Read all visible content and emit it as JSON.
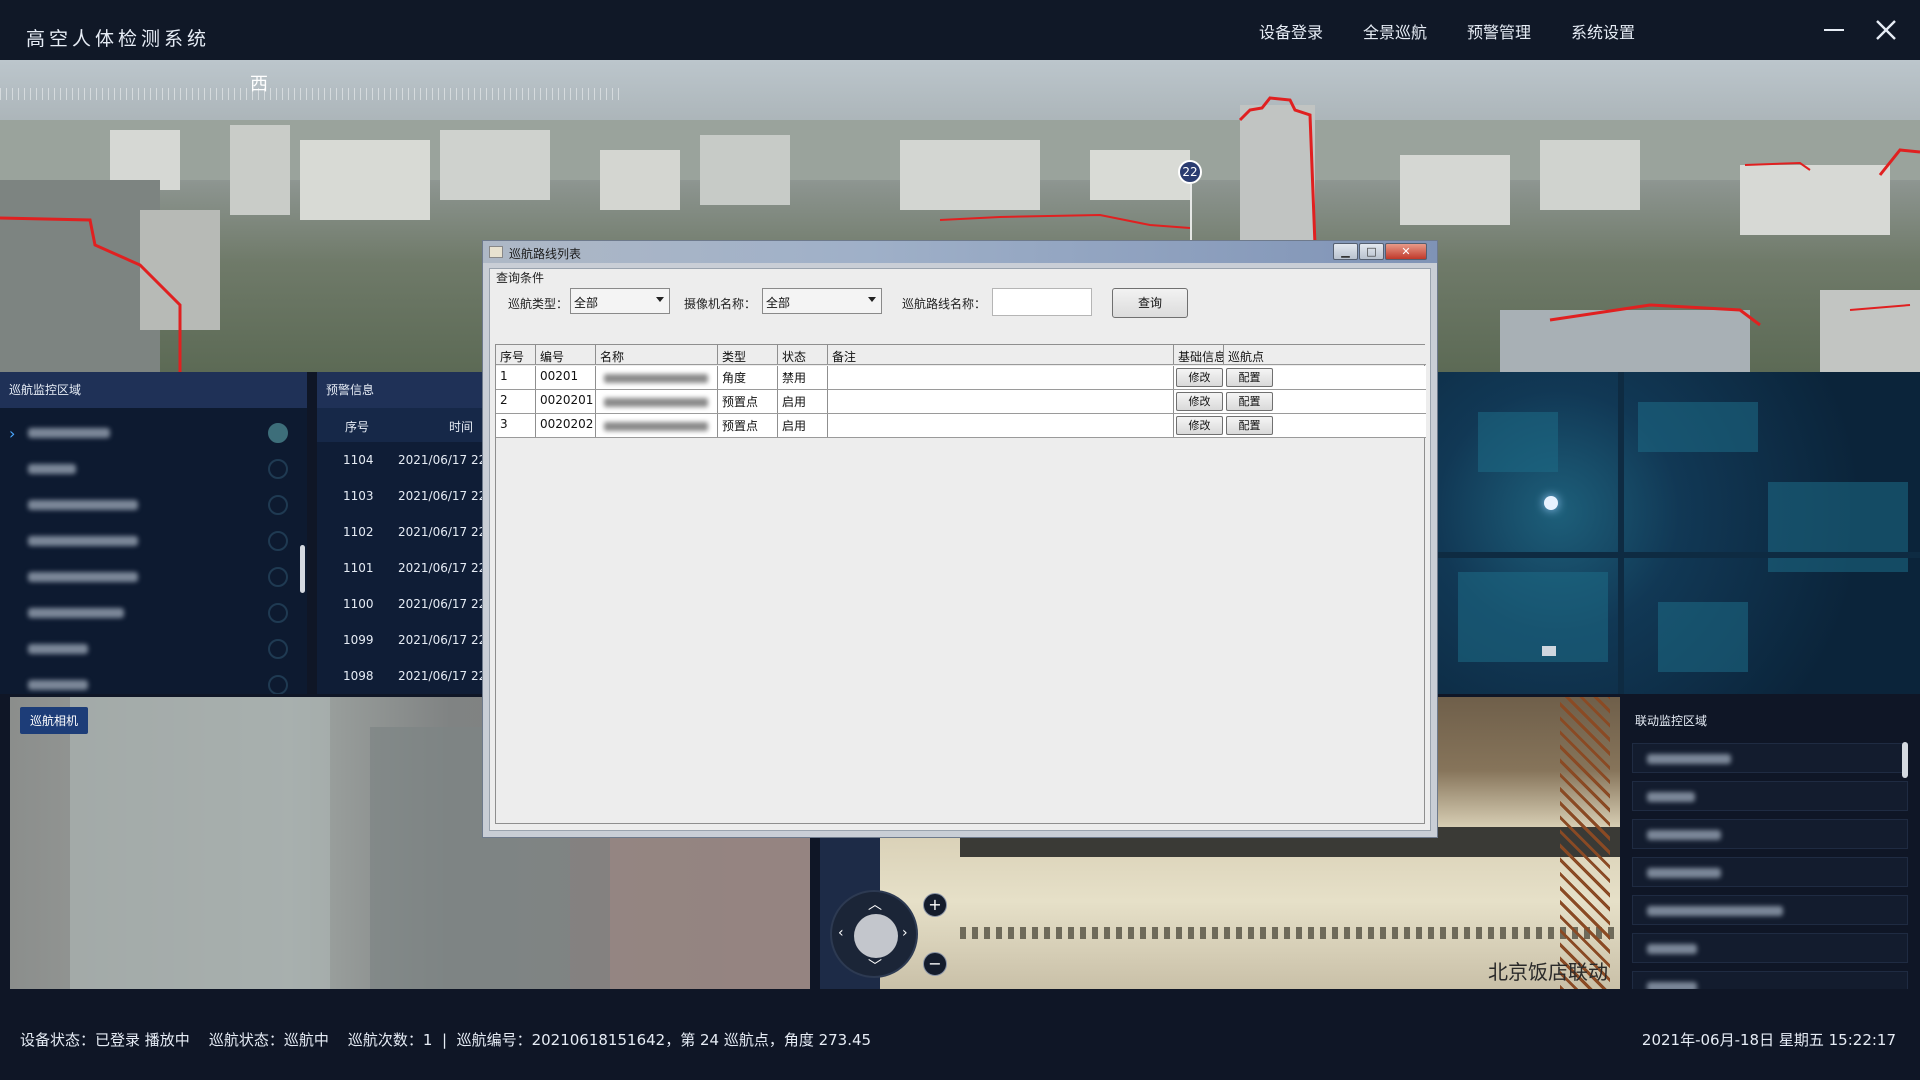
{
  "app": {
    "title": "高空人体检测系统"
  },
  "nav": {
    "items": [
      "设备登录",
      "全景巡航",
      "预警管理",
      "系统设置"
    ]
  },
  "window_controls": {
    "minimize_icon": "minimize-icon",
    "close_icon": "close-icon"
  },
  "panorama": {
    "compass_label": "西",
    "marker_number": "22",
    "bottom_sign": "北京饭店"
  },
  "patrol_region": {
    "title": "巡航监控区域",
    "selected_index": 0
  },
  "alerts": {
    "title": "预警信息",
    "columns": [
      "序号",
      "时间"
    ],
    "rows": [
      {
        "id": "1104",
        "time": "2021/06/17 22"
      },
      {
        "id": "1103",
        "time": "2021/06/17 22"
      },
      {
        "id": "1102",
        "time": "2021/06/17 22"
      },
      {
        "id": "1101",
        "time": "2021/06/17 22"
      },
      {
        "id": "1100",
        "time": "2021/06/17 22"
      },
      {
        "id": "1099",
        "time": "2021/06/17 22"
      },
      {
        "id": "1098",
        "time": "2021/06/17 22"
      }
    ]
  },
  "video": {
    "patrol_camera_label": "巡航相机",
    "caption": "北京饭店联动"
  },
  "linkage": {
    "title": "联动监控区域"
  },
  "status": {
    "left": "设备状态：已登录 播放中    巡航状态：巡航中    巡航次数：1  |  巡航编号：20210618151642，第 24 巡航点，角度 273.45",
    "right": "2021年-06月-18日 星期五 15:22:17"
  },
  "dialog": {
    "title": "巡航路线列表",
    "group_label": "查询条件",
    "query": {
      "patrol_type_label": "巡航类型：",
      "patrol_type_value": "全部",
      "camera_name_label": "摄像机名称：",
      "camera_name_value": "全部",
      "route_name_label": "巡航路线名称：",
      "route_name_value": "",
      "search_button": "查询"
    },
    "grid": {
      "columns": [
        "序号",
        "编号",
        "名称",
        "类型",
        "状态",
        "备注",
        "基础信息",
        "巡航点"
      ],
      "rows": [
        {
          "seq": "1",
          "code": "00201",
          "type": "角度",
          "status": "禁用",
          "note": "",
          "edit": "修改",
          "config": "配置"
        },
        {
          "seq": "2",
          "code": "0020201",
          "type": "预置点",
          "status": "启用",
          "note": "",
          "edit": "修改",
          "config": "配置"
        },
        {
          "seq": "3",
          "code": "0020202",
          "type": "预置点",
          "status": "启用",
          "note": "",
          "edit": "修改",
          "config": "配置"
        }
      ]
    },
    "controls": {
      "minimize": "▁",
      "maximize": "□",
      "close": "✕"
    }
  },
  "colors": {
    "background": "#0f1626",
    "panel_header": "#1f3157",
    "accent_blue": "#1d3d78",
    "text": "#e6ecf5",
    "building_outline": "#e02020"
  }
}
